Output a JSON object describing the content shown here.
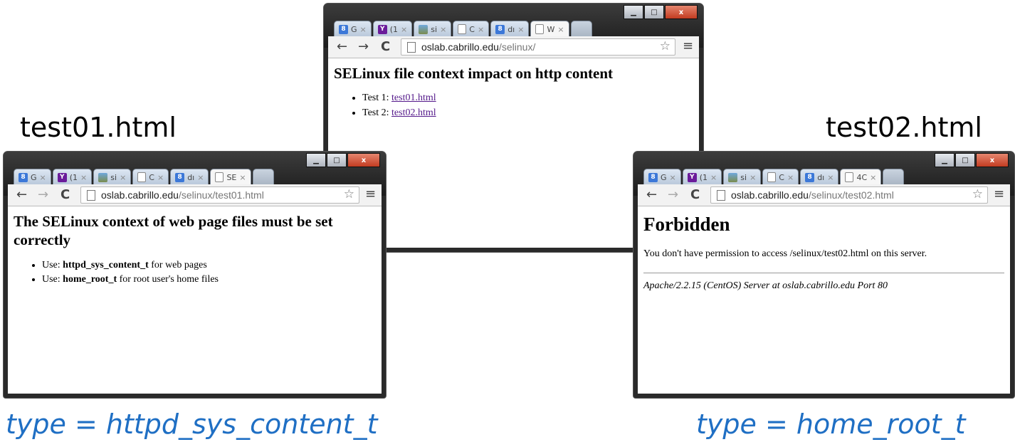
{
  "captions": {
    "left_top": "test01.html",
    "right_top": "test02.html",
    "left_bottom": "type = httpd_sys_content_t",
    "right_bottom": "type = home_root_t"
  },
  "tabs_common": {
    "google": "G",
    "yahoo": "(1",
    "images": "si",
    "doc": "C",
    "drive": "dı",
    "close": "×"
  },
  "window_center": {
    "active_tab": "W",
    "url_host": "oslab.cabrillo.edu",
    "url_path": "/selinux/",
    "heading": "SELinux file context impact on http content",
    "items": [
      {
        "prefix": "Test 1: ",
        "link": "test01.html"
      },
      {
        "prefix": "Test 2: ",
        "link": "test02.html"
      }
    ]
  },
  "window_left": {
    "active_tab": "SE",
    "url_host": "oslab.cabrillo.edu",
    "url_path": "/selinux/test01.html",
    "heading": "The SELinux context of web page files must be set correctly",
    "items": [
      {
        "prefix": "Use: ",
        "bold": "httpd_sys_content_t",
        "suffix": " for web pages"
      },
      {
        "prefix": "Use: ",
        "bold": "home_root_t",
        "suffix": " for root user's home files"
      }
    ]
  },
  "window_right": {
    "active_tab": "4C",
    "url_host": "oslab.cabrillo.edu",
    "url_path": "/selinux/test02.html",
    "heading": "Forbidden",
    "message": "You don't have permission to access /selinux/test02.html on this server.",
    "server": "Apache/2.2.15 (CentOS) Server at oslab.cabrillo.edu Port 80"
  },
  "icons": {
    "back": "←",
    "forward": "→",
    "reload": "C",
    "star": "☆",
    "menu": "≡",
    "minimize": "▁",
    "maximize": "□",
    "close": "x"
  }
}
